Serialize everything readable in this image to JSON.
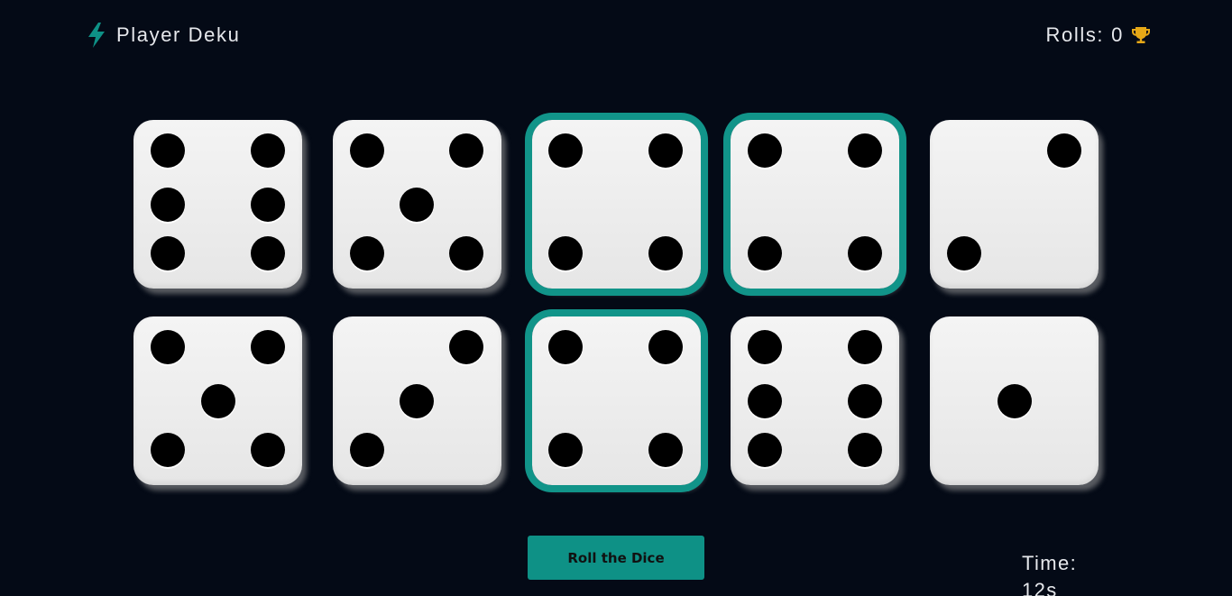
{
  "header": {
    "player_name": "Player Deku",
    "rolls_label": "Rolls:",
    "rolls_value": "0",
    "left_icon": "bolt-icon",
    "right_icon": "trophy-icon"
  },
  "colors": {
    "background": "#040a16",
    "accent": "#0e9186",
    "held_border": "#119489",
    "trophy": "#e6a817"
  },
  "dice": [
    {
      "value": 6,
      "held": false
    },
    {
      "value": 5,
      "held": false
    },
    {
      "value": 4,
      "held": true
    },
    {
      "value": 4,
      "held": true
    },
    {
      "value": 2,
      "held": false
    },
    {
      "value": 5,
      "held": false
    },
    {
      "value": 3,
      "held": false
    },
    {
      "value": 4,
      "held": true
    },
    {
      "value": 6,
      "held": false
    },
    {
      "value": 1,
      "held": false
    }
  ],
  "controls": {
    "roll_button_label": "Roll the Dice"
  },
  "timer": {
    "label": "Time:",
    "value": "12s"
  }
}
